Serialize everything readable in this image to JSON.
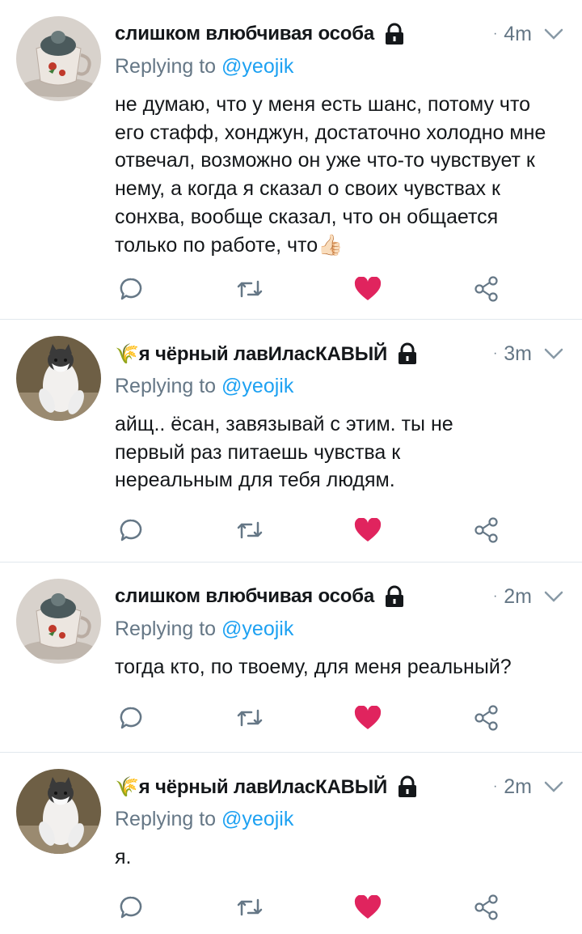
{
  "colors": {
    "accent": "#1da1f2",
    "muted": "#657786",
    "like": "#e0245e",
    "text": "#14171a",
    "divider": "#e1e8ed"
  },
  "tweets": [
    {
      "author": "слишком влюбчивая особа",
      "avatar": "teacup-avatar",
      "time": "4m",
      "replying_prefix": "Replying to ",
      "replying_handle": "@yeojik",
      "text": "не думаю, что у меня есть шанс, потому что его стафф, хонджун, достаточно холодно мне отвечал, возможно он уже что-то чувствует к нему, а когда я сказал о своих чувствах к сонхва, вообще сказал, что он общается только по работе, что👍🏻"
    },
    {
      "author": "🌾я чёрный лавИласКАВЫЙ",
      "avatar": "cat-avatar",
      "time": "3m",
      "replying_prefix": "Replying to ",
      "replying_handle": "@yeojik",
      "text": "айщ.. ёсан, завязывай с этим. ты не первый раз питаешь чувства к нереальным для тебя людям."
    },
    {
      "author": "слишком влюбчивая особа",
      "avatar": "teacup-avatar",
      "time": "2m",
      "replying_prefix": "Replying to ",
      "replying_handle": "@yeojik",
      "text": "тогда кто, по твоему, для меня реальный?"
    },
    {
      "author": "🌾я чёрный лавИласКАВЫЙ",
      "avatar": "cat-avatar",
      "time": "2m",
      "replying_prefix": "Replying to ",
      "replying_handle": "@yeojik",
      "text": "я."
    }
  ],
  "icons": {
    "lock": "lock-icon",
    "chevron": "chevron-down-icon",
    "reply": "reply-icon",
    "retweet": "retweet-icon",
    "like": "heart-icon",
    "share": "share-icon"
  }
}
